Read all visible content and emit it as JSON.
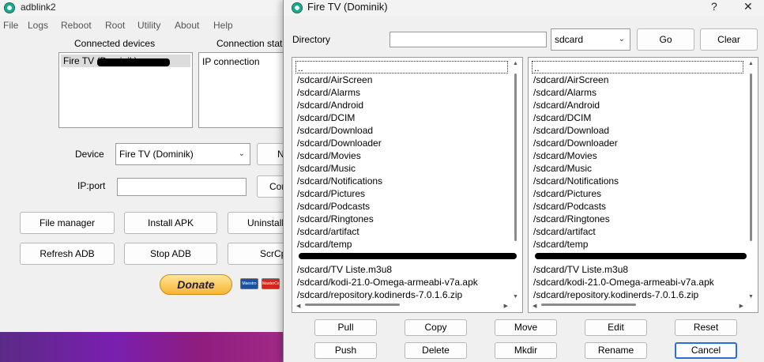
{
  "main_window": {
    "title": "adblink2",
    "menu": [
      "File",
      "Logs",
      "Reboot",
      "Root",
      "Utility",
      "About",
      "Help"
    ],
    "connected_devices_label": "Connected devices",
    "connected_devices": [
      "Fire TV (Dominik)"
    ],
    "connection_status_label": "Connection stat",
    "connection_status_value": "IP connection",
    "device_label": "Device",
    "device_value": "Fire TV (Dominik)",
    "device_button": "N",
    "ip_port_label": "IP:port",
    "ip_port_value": "",
    "connect_button": "Con",
    "buttons": {
      "file_manager": "File manager",
      "install_apk": "Install APK",
      "uninstall": "Uninstall",
      "refresh_adb": "Refresh ADB",
      "stop_adb": "Stop ADB",
      "scrcpy": "ScrCp"
    },
    "donate_label": "Donate",
    "card_labels": [
      "Maestro",
      "MasterCard"
    ]
  },
  "dialog": {
    "title": "Fire TV (Dominik)",
    "help_glyph": "?",
    "close_glyph": "✕",
    "directory_label": "Directory",
    "directory_value": "",
    "location_value": "sdcard",
    "go_button": "Go",
    "clear_button": "Clear",
    "left_files": [
      "..",
      "/sdcard/AirScreen",
      "/sdcard/Alarms",
      "/sdcard/Android",
      "/sdcard/DCIM",
      "/sdcard/Download",
      "/sdcard/Downloader",
      "/sdcard/Movies",
      "/sdcard/Music",
      "/sdcard/Notifications",
      "/sdcard/Pictures",
      "/sdcard/Podcasts",
      "/sdcard/Ringtones",
      "/sdcard/artifact",
      "/sdcard/temp",
      "",
      "/sdcard/TV Liste.m3u8",
      "/sdcard/kodi-21.0-Omega-armeabi-v7a.apk",
      "/sdcard/repository.kodinerds-7.0.1.6.zip"
    ],
    "right_files": [
      "..",
      "/sdcard/AirScreen",
      "/sdcard/Alarms",
      "/sdcard/Android",
      "/sdcard/DCIM",
      "/sdcard/Download",
      "/sdcard/Downloader",
      "/sdcard/Movies",
      "/sdcard/Music",
      "/sdcard/Notifications",
      "/sdcard/Pictures",
      "/sdcard/Podcasts",
      "/sdcard/Ringtones",
      "/sdcard/artifact",
      "/sdcard/temp",
      "",
      "/sdcard/TV Liste.m3u8",
      "/sdcard/kodi-21.0-Omega-armeabi-v7a.apk",
      "/sdcard/repository.kodinerds-7.0.1.6.zip"
    ],
    "actions_row1": [
      "Pull",
      "Copy",
      "Move",
      "Edit",
      "Reset"
    ],
    "actions_row2": [
      "Push",
      "Delete",
      "Mkdir",
      "Rename",
      "Cancel"
    ]
  },
  "colors": {
    "cancel_border": "#2a6fd6",
    "desktop": "#7a1fb0",
    "selection": "#dcdcdc"
  }
}
